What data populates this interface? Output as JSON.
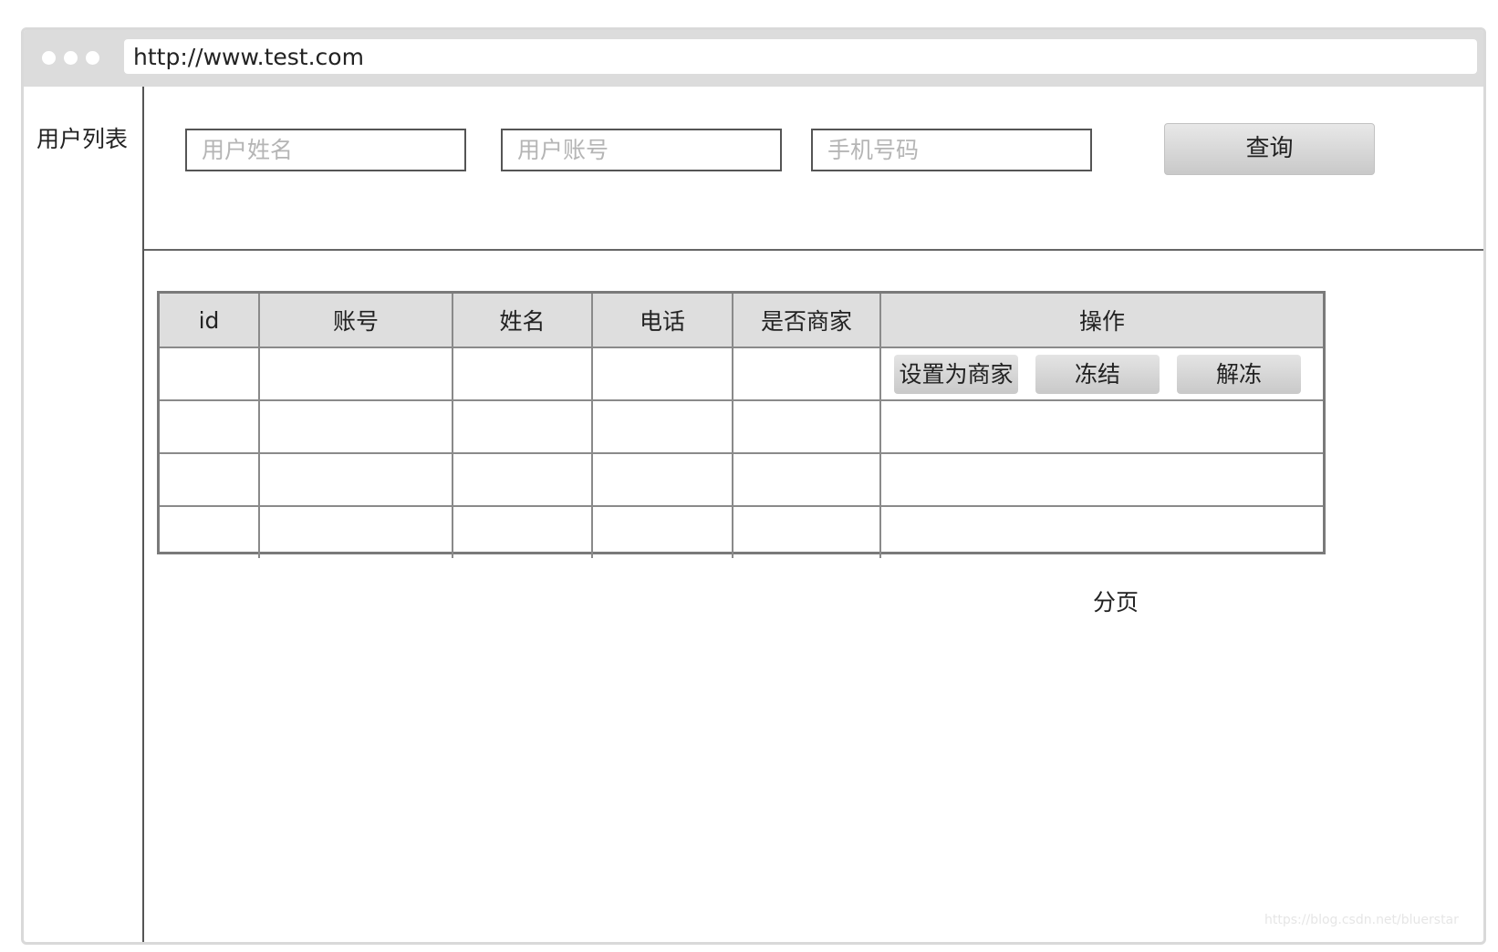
{
  "browser": {
    "url": "http://www.test.com"
  },
  "sidebar": {
    "items": [
      {
        "label": "用户列表"
      }
    ]
  },
  "search": {
    "name_placeholder": "用户姓名",
    "account_placeholder": "用户账号",
    "phone_placeholder": "手机号码",
    "query_label": "查询"
  },
  "table": {
    "columns": [
      "id",
      "账号",
      "姓名",
      "电话",
      "是否商家",
      "操作"
    ],
    "rows": [
      [
        "",
        "",
        "",
        "",
        ""
      ],
      [
        "",
        "",
        "",
        "",
        ""
      ],
      [
        "",
        "",
        "",
        "",
        ""
      ],
      [
        "",
        "",
        "",
        "",
        ""
      ]
    ],
    "actions": [
      "设置为商家",
      "冻结",
      "解冻"
    ]
  },
  "pagination": {
    "label": "分页"
  },
  "watermark": "https://blog.csdn.net/bluerstar"
}
